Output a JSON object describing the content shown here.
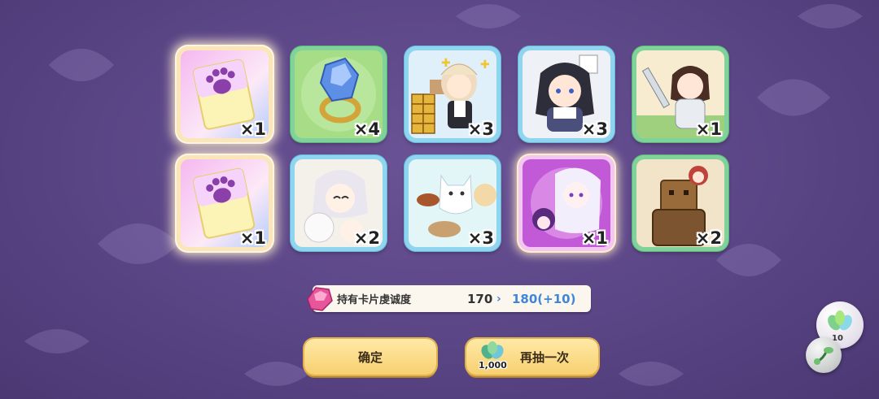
{
  "rewards": [
    {
      "name": "paw-ticket",
      "count": "×1",
      "frame": "gold"
    },
    {
      "name": "blue-gem-ring",
      "count": "×4",
      "frame": "green"
    },
    {
      "name": "maid-boxes-card",
      "count": "×3",
      "frame": "blue"
    },
    {
      "name": "dark-hair-girl-card",
      "count": "×3",
      "frame": "blue"
    },
    {
      "name": "knight-girl-card",
      "count": "×1",
      "frame": "green"
    },
    {
      "name": "paw-ticket",
      "count": "×1",
      "frame": "gold"
    },
    {
      "name": "white-hair-girl-card",
      "count": "×2",
      "frame": "blue"
    },
    {
      "name": "cat-ghost-card",
      "count": "×3",
      "frame": "blue"
    },
    {
      "name": "purple-hair-girl-card",
      "count": "×1",
      "frame": "pink"
    },
    {
      "name": "wooden-golem-card",
      "count": "×2",
      "frame": "green"
    }
  ],
  "affinity": {
    "label": "持有卡片虔诚度",
    "current": "170",
    "arrow": "›",
    "next": "180(+10)"
  },
  "buttons": {
    "confirm": "确定",
    "redraw": "再抽一次",
    "redraw_cost": "1,000"
  },
  "side_item": {
    "count": "10"
  },
  "colors": {
    "background": "#5a4585",
    "button": "#f7d070",
    "next_value": "#3f86d8"
  }
}
